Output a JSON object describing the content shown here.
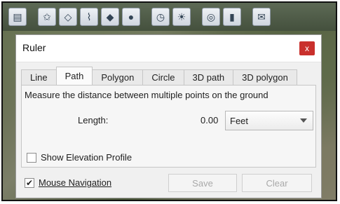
{
  "dialog": {
    "title": "Ruler",
    "close_label": "x",
    "tabs": [
      "Line",
      "Path",
      "Polygon",
      "Circle",
      "3D path",
      "3D polygon"
    ],
    "active_tab": "Path",
    "description": "Measure the distance between multiple points on the ground",
    "length_label": "Length:",
    "length_value": "0.00",
    "unit": "Feet",
    "show_elevation_label": "Show Elevation Profile",
    "show_elevation_checked": false,
    "mouse_navigation_label": "Mouse Navigation",
    "mouse_navigation_checked": true,
    "mouse_navigation_check": "✔",
    "save_label": "Save",
    "clear_label": "Clear"
  },
  "toolbar": {
    "icons": [
      "sidebar-icon",
      "placemark-icon",
      "polygon-icon",
      "path-icon",
      "overlay-icon",
      "tour-icon",
      "historical-imagery-icon",
      "sunlight-icon",
      "planets-icon",
      "ruler-icon",
      "email-icon"
    ]
  },
  "colors": {
    "close_button": "#c9302c",
    "dialog_bg": "#f0f0f0"
  }
}
